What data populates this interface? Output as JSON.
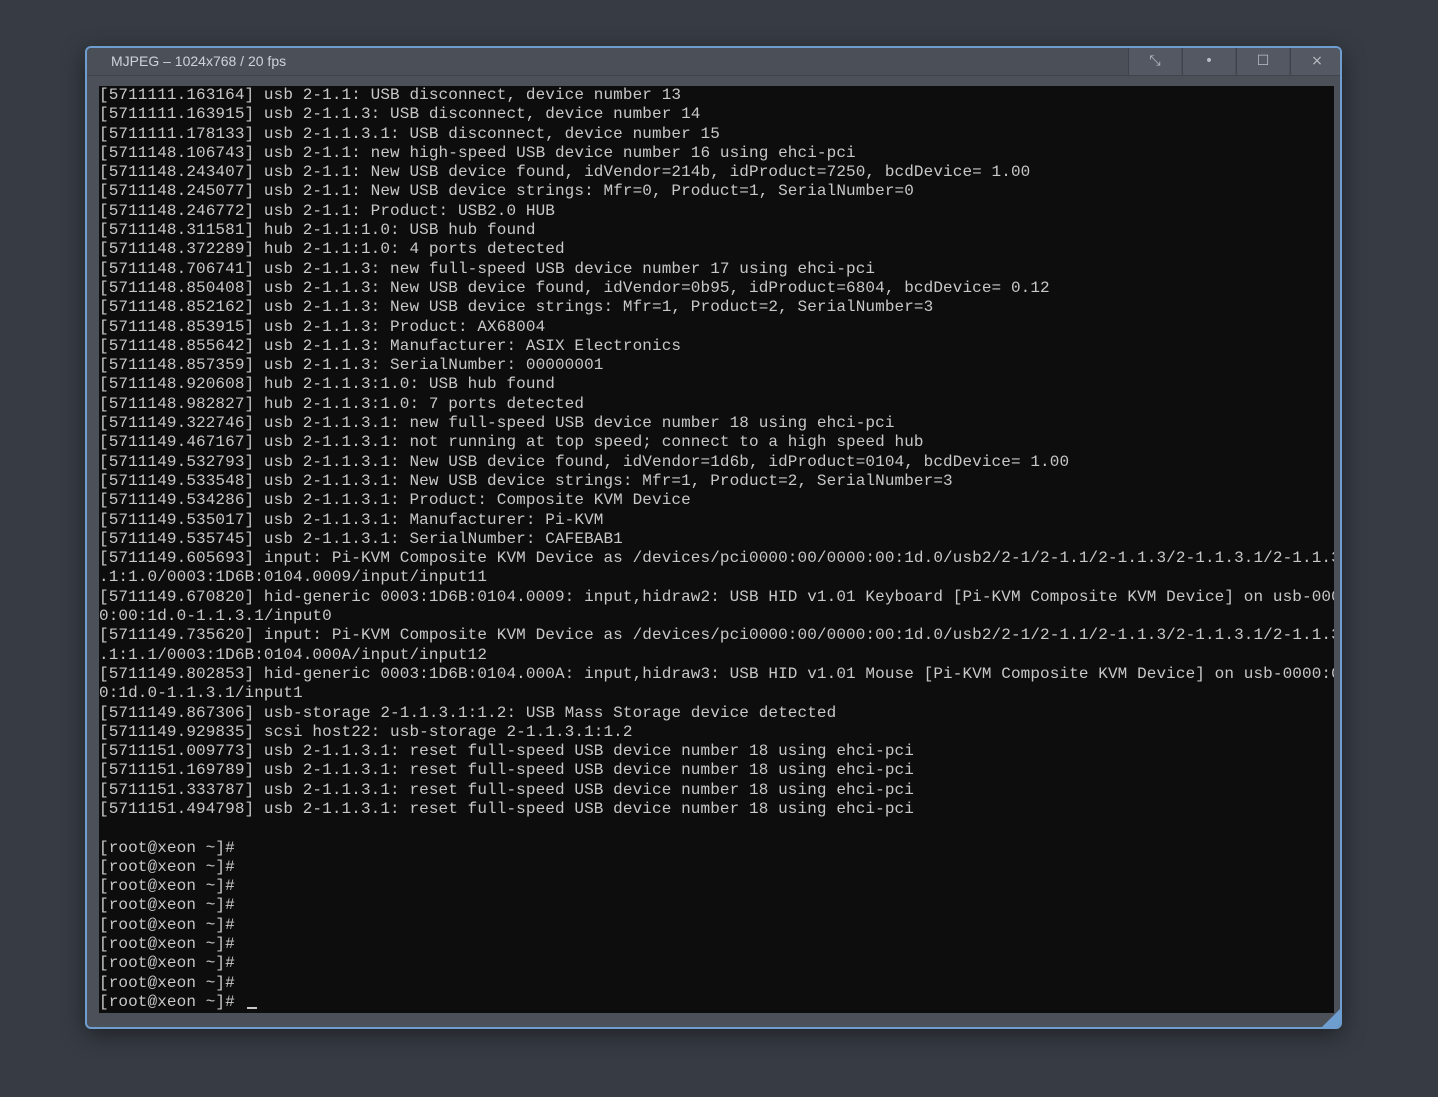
{
  "window": {
    "title": "MJPEG – 1024x768 / 20 fps",
    "buttons": {
      "fullscreen_icon": "⤡",
      "dot_icon": "•",
      "maximize_icon": "☐",
      "close_icon": "×"
    },
    "accent_color": "#6e9ecf"
  },
  "terminal": {
    "lines": [
      "[5711111.163164] usb 2-1.1: USB disconnect, device number 13",
      "[5711111.163915] usb 2-1.1.3: USB disconnect, device number 14",
      "[5711111.178133] usb 2-1.1.3.1: USB disconnect, device number 15",
      "[5711148.106743] usb 2-1.1: new high-speed USB device number 16 using ehci-pci",
      "[5711148.243407] usb 2-1.1: New USB device found, idVendor=214b, idProduct=7250, bcdDevice= 1.00",
      "[5711148.245077] usb 2-1.1: New USB device strings: Mfr=0, Product=1, SerialNumber=0",
      "[5711148.246772] usb 2-1.1: Product: USB2.0 HUB",
      "[5711148.311581] hub 2-1.1:1.0: USB hub found",
      "[5711148.372289] hub 2-1.1:1.0: 4 ports detected",
      "[5711148.706741] usb 2-1.1.3: new full-speed USB device number 17 using ehci-pci",
      "[5711148.850408] usb 2-1.1.3: New USB device found, idVendor=0b95, idProduct=6804, bcdDevice= 0.12",
      "[5711148.852162] usb 2-1.1.3: New USB device strings: Mfr=1, Product=2, SerialNumber=3",
      "[5711148.853915] usb 2-1.1.3: Product: AX68004",
      "[5711148.855642] usb 2-1.1.3: Manufacturer: ASIX Electronics",
      "[5711148.857359] usb 2-1.1.3: SerialNumber: 00000001",
      "[5711148.920608] hub 2-1.1.3:1.0: USB hub found",
      "[5711148.982827] hub 2-1.1.3:1.0: 7 ports detected",
      "[5711149.322746] usb 2-1.1.3.1: new full-speed USB device number 18 using ehci-pci",
      "[5711149.467167] usb 2-1.1.3.1: not running at top speed; connect to a high speed hub",
      "[5711149.532793] usb 2-1.1.3.1: New USB device found, idVendor=1d6b, idProduct=0104, bcdDevice= 1.00",
      "[5711149.533548] usb 2-1.1.3.1: New USB device strings: Mfr=1, Product=2, SerialNumber=3",
      "[5711149.534286] usb 2-1.1.3.1: Product: Composite KVM Device",
      "[5711149.535017] usb 2-1.1.3.1: Manufacturer: Pi-KVM",
      "[5711149.535745] usb 2-1.1.3.1: SerialNumber: CAFEBAB1",
      "[5711149.605693] input: Pi-KVM Composite KVM Device as /devices/pci0000:00/0000:00:1d.0/usb2/2-1/2-1.1/2-1.1.3/2-1.1.3.1/2-1.1.3",
      ".1:1.0/0003:1D6B:0104.0009/input/input11",
      "[5711149.670820] hid-generic 0003:1D6B:0104.0009: input,hidraw2: USB HID v1.01 Keyboard [Pi-KVM Composite KVM Device] on usb-000",
      "0:00:1d.0-1.1.3.1/input0",
      "[5711149.735620] input: Pi-KVM Composite KVM Device as /devices/pci0000:00/0000:00:1d.0/usb2/2-1/2-1.1/2-1.1.3/2-1.1.3.1/2-1.1.3",
      ".1:1.1/0003:1D6B:0104.000A/input/input12",
      "[5711149.802853] hid-generic 0003:1D6B:0104.000A: input,hidraw3: USB HID v1.01 Mouse [Pi-KVM Composite KVM Device] on usb-0000:0",
      "0:1d.0-1.1.3.1/input1",
      "[5711149.867306] usb-storage 2-1.1.3.1:1.2: USB Mass Storage device detected",
      "[5711149.929835] scsi host22: usb-storage 2-1.1.3.1:1.2",
      "[5711151.009773] usb 2-1.1.3.1: reset full-speed USB device number 18 using ehci-pci",
      "[5711151.169789] usb 2-1.1.3.1: reset full-speed USB device number 18 using ehci-pci",
      "[5711151.333787] usb 2-1.1.3.1: reset full-speed USB device number 18 using ehci-pci",
      "[5711151.494798] usb 2-1.1.3.1: reset full-speed USB device number 18 using ehci-pci",
      "",
      "[root@xeon ~]#",
      "[root@xeon ~]#",
      "[root@xeon ~]#",
      "[root@xeon ~]#",
      "[root@xeon ~]#",
      "[root@xeon ~]#",
      "[root@xeon ~]#",
      "[root@xeon ~]#",
      "[root@xeon ~]# "
    ]
  }
}
